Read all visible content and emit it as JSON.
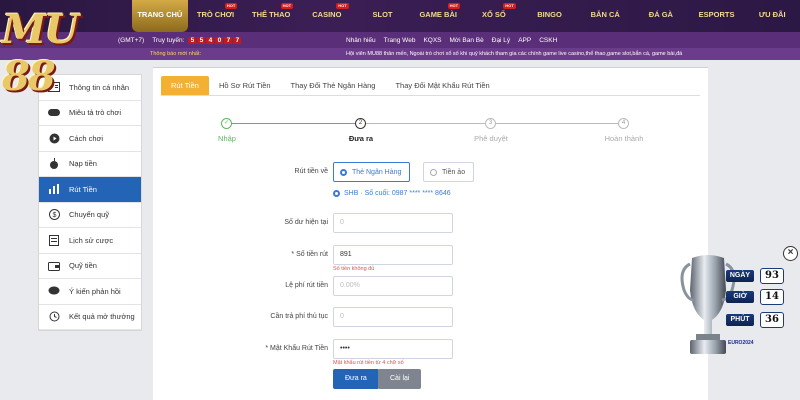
{
  "brand": {
    "logo": "MU 88"
  },
  "nav": [
    {
      "label": "TRANG CHỦ",
      "hot": false,
      "active": true
    },
    {
      "label": "TRÒ CHƠI",
      "hot": true,
      "active": false
    },
    {
      "label": "THỂ THAO",
      "hot": true,
      "active": false
    },
    {
      "label": "CASINO",
      "hot": true,
      "active": false
    },
    {
      "label": "SLOT",
      "hot": false,
      "active": false
    },
    {
      "label": "GAME BÀI",
      "hot": true,
      "active": false
    },
    {
      "label": "XỔ SỐ",
      "hot": true,
      "active": false
    },
    {
      "label": "BINGO",
      "hot": false,
      "active": false
    },
    {
      "label": "BẮN CÁ",
      "hot": false,
      "active": false
    },
    {
      "label": "ĐÁ GÀ",
      "hot": false,
      "active": false
    },
    {
      "label": "ESPORTS",
      "hot": false,
      "active": false
    },
    {
      "label": "ƯU ĐÃI",
      "hot": false,
      "active": false
    }
  ],
  "hot_badge": "HOT",
  "subbar": {
    "clock": "(GMT+7)",
    "visits_label": "Truy tuyến:",
    "counter": [
      "5",
      "5",
      "4",
      "0",
      "7",
      "7"
    ],
    "notice": "Thông báo mới nhất:",
    "ticker": "C THẢ GA HOÀN TRẢ 2.5% KHÔNG GIỚI HẠN",
    "links": [
      "Nhân hiếu",
      "Trang Web",
      "KQXS",
      "Mời Ban Bè",
      "Đại Lý",
      "APP",
      "CSKH"
    ]
  },
  "marquee": {
    "m1": "Thông báo mới nhất:",
    "m2": "Hội viên MU88 thân mến, Ngoài trò chơi xổ số khi quý khách tham gia các chính game live casino,thể thao,game slot,bắn cá, game bài,đá"
  },
  "sidebar": [
    {
      "label": "Thông tin cá nhân",
      "icon": "user-card-icon",
      "active": false
    },
    {
      "label": "Miêu tả trò chơi",
      "icon": "gamepad-icon",
      "active": false
    },
    {
      "label": "Cách chơi",
      "icon": "play-circle-icon",
      "active": false
    },
    {
      "label": "Nạp tiền",
      "icon": "apple-icon",
      "active": false
    },
    {
      "label": "Rút Tiền",
      "icon": "bar-chart-icon",
      "active": true
    },
    {
      "label": "Chuyển quỹ",
      "icon": "coin-icon",
      "active": false
    },
    {
      "label": "Lịch sử cược",
      "icon": "history-list-icon",
      "active": false
    },
    {
      "label": "Quỹ tiền",
      "icon": "wallet-icon",
      "active": false
    },
    {
      "label": "Ý kiến phản hồi",
      "icon": "chat-icon",
      "active": false
    },
    {
      "label": "Kết quả mở thưởng",
      "icon": "clock-history-icon",
      "active": false
    }
  ],
  "tabs": [
    {
      "label": "Rút Tiền",
      "active": true
    },
    {
      "label": "Hồ Sơ Rút Tiền",
      "active": false
    },
    {
      "label": "Thay Đổi Thẻ Ngân Hàng",
      "active": false
    },
    {
      "label": "Thay Đổi Mật Khẩu Rút Tiền",
      "active": false
    }
  ],
  "steps": [
    {
      "num": "✓",
      "label": "Nhập",
      "state": "done"
    },
    {
      "num": "2",
      "label": "Đưa ra",
      "state": "cur"
    },
    {
      "num": "3",
      "label": "Phê duyệt",
      "state": "todo"
    },
    {
      "num": "4",
      "label": "Hoàn thành",
      "state": "todo"
    }
  ],
  "form": {
    "withdraw_to_label": "Rút tiền về",
    "option_bank": "Thẻ Ngân Hàng",
    "option_crypto": "Tiền ảo",
    "bank_line": "SHB · Số cuối: 0987 **** **** 8646",
    "balance_label": "Số dư hiện tại",
    "balance_value": "0",
    "amount_label": "* Số tiền rút",
    "amount_value": "891",
    "amount_error": "Số tiền không đủ",
    "fee_label": "Lệ phí rút tiền",
    "fee_value": "0.00%",
    "proc_fee_label": "Cần trả phí thủ tục",
    "proc_fee_value": "0",
    "password_label": "* Mật Khẩu Rút Tiền",
    "password_value": "••••",
    "password_error": "Mật khẩu rút tiền từ 4 chữ số",
    "submit": "Đưa ra",
    "reset": "Cài lại"
  },
  "countdown": {
    "close": "×",
    "euro_label": "EURO2024",
    "rows": [
      {
        "label": "NGÀY",
        "value": "93"
      },
      {
        "label": "GIỜ",
        "value": "14"
      },
      {
        "label": "PHÚT",
        "value": "36"
      }
    ]
  }
}
